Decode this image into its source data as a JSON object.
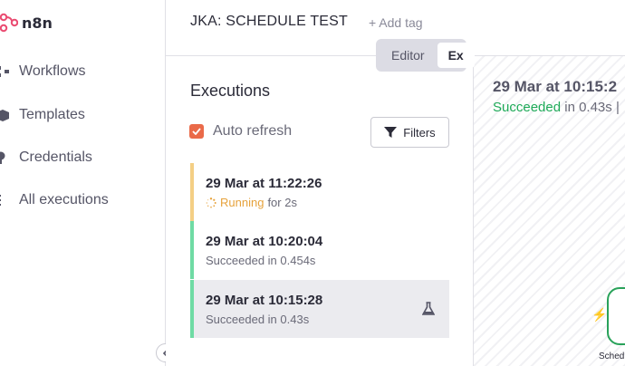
{
  "app": {
    "logo_text": "n8n",
    "brand_color": "#ea4b71"
  },
  "sidebar": {
    "items": [
      {
        "label": "Workflows",
        "icon": "network-icon"
      },
      {
        "label": "Templates",
        "icon": "box-icon"
      },
      {
        "label": "Credentials",
        "icon": "key-icon"
      },
      {
        "label": "All executions",
        "icon": "list-icon"
      }
    ]
  },
  "header": {
    "workflow_title": "JKA: SCHEDULE TEST",
    "add_tag": "+ Add tag",
    "tabs": [
      {
        "label": "Editor",
        "active": false
      },
      {
        "label": "Ex",
        "active": true
      }
    ]
  },
  "executions": {
    "heading": "Executions",
    "auto_refresh_label": "Auto refresh",
    "auto_refresh_checked": true,
    "filters_label": "Filters",
    "items": [
      {
        "time": "29 Mar at 11:22:26",
        "status_word": "Running",
        "status_rest": "for 2s",
        "state": "running",
        "color": "#f4cf85"
      },
      {
        "time": "29 Mar at 10:20:04",
        "status_text": "Succeeded in 0.454s",
        "state": "success",
        "color": "#6fdba4"
      },
      {
        "time": "29 Mar at 10:15:28",
        "status_text": "Succeeded in 0.43s",
        "state": "success",
        "selected": true,
        "color": "#6fdba4"
      }
    ]
  },
  "preview": {
    "time": "29 Mar at 10:15:2",
    "status_word": "Succeeded",
    "status_rest": "in 0.43s |",
    "node_label": "Sched"
  },
  "colors": {
    "accent": "#ea6a49",
    "running": "#e6a23c",
    "success": "#1eaa58"
  }
}
